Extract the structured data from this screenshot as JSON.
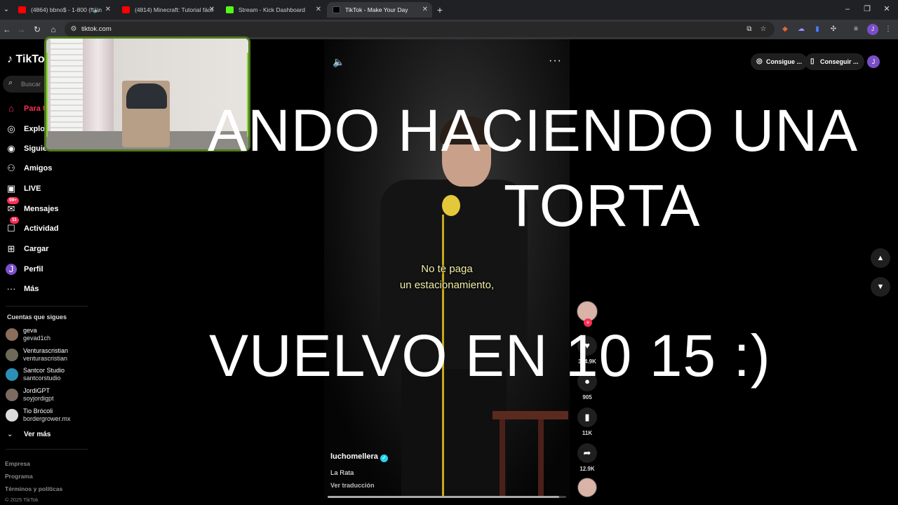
{
  "browser": {
    "tabs": [
      {
        "title": "(4864) bbno$ - 1-800 (ft. in",
        "favicon": "youtube",
        "muted": true
      },
      {
        "title": "(4814) Minecraft: Tutorial fácil",
        "favicon": "youtube"
      },
      {
        "title": "Stream - Kick Dashboard",
        "favicon": "kick"
      },
      {
        "title": "TikTok - Make Your Day",
        "favicon": "tiktok",
        "active": true
      }
    ],
    "url": "tiktok.com",
    "profile_initial": "J"
  },
  "tiktok": {
    "logo": "TikTok",
    "search_placeholder": "Buscar",
    "nav": [
      {
        "label": "Para ti",
        "icon": "home-icon",
        "active": true
      },
      {
        "label": "Explorar",
        "icon": "compass-icon"
      },
      {
        "label": "Siguiendo",
        "icon": "following-icon"
      },
      {
        "label": "Amigos",
        "icon": "friends-icon"
      },
      {
        "label": "LIVE",
        "icon": "live-icon"
      },
      {
        "label": "Mensajes",
        "icon": "messages-icon",
        "badge": "99+"
      },
      {
        "label": "Actividad",
        "icon": "activity-icon",
        "badge": "11"
      },
      {
        "label": "Cargar",
        "icon": "upload-icon"
      },
      {
        "label": "Perfil",
        "icon": "profile-icon",
        "avatar": "J"
      },
      {
        "label": "Más",
        "icon": "more-icon"
      }
    ],
    "following_title": "Cuentas que sigues",
    "following": [
      {
        "name": "geva",
        "handle": "gevad1ch"
      },
      {
        "name": "Venturascristian",
        "handle": "venturascristian"
      },
      {
        "name": "Santcor Studio",
        "handle": "santcorstudio"
      },
      {
        "name": "JordiGPT",
        "handle": "soyjordigpt"
      },
      {
        "name": "Tio Brócoli",
        "handle": "bordergrower.mx"
      }
    ],
    "see_more": "Ver más",
    "footer": {
      "company": "Empresa",
      "program": "Programa",
      "terms": "Términos y políticas",
      "copyright": "© 2025 TikTok"
    },
    "top_buttons": {
      "coins": "Consigue ...",
      "app": "Conseguir ..."
    },
    "video": {
      "caption_line1": "No te paga",
      "caption_line2": "un estacionamiento,",
      "author": "luchomellera",
      "description": "La Rata",
      "translate": "Ver traducción",
      "progress": 0.97
    },
    "actions": {
      "likes": "334.9K",
      "comments": "905",
      "saves": "11K",
      "shares": "12.9K"
    }
  },
  "overlay": {
    "line1": "ANDO HACIENDO UNA",
    "line2": "TORTA",
    "line3": "VUELVO EN 10 15 :)"
  }
}
